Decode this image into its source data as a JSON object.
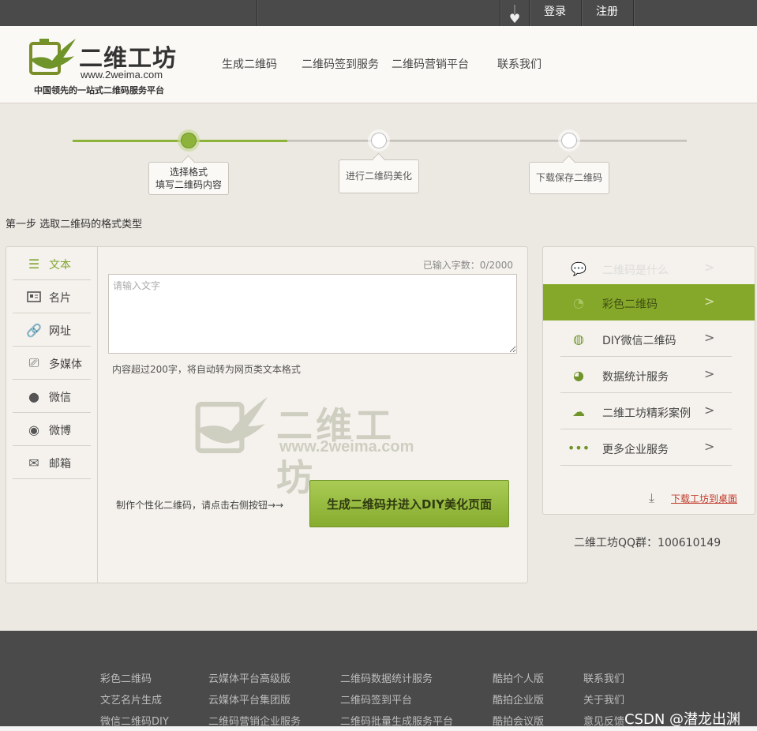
{
  "topbar": {
    "login": "登录",
    "register": "注册"
  },
  "header": {
    "logo_title": "二维工坊",
    "logo_url": "www.2weima.com",
    "slogan": "中国领先的一站式二维码服务平台",
    "nav": [
      "生成二维码",
      "二维码签到服务",
      "二维码营销平台",
      "联系我们"
    ]
  },
  "steps": [
    {
      "line1": "选择格式",
      "line2": "填写二维码内容"
    },
    {
      "line1": "进行二维码美化",
      "line2": ""
    },
    {
      "line1": "下载保存二维码",
      "line2": ""
    }
  ],
  "progress_fraction": 0.35,
  "step_label": "第一步 选取二维码的格式类型",
  "tabs": [
    {
      "label": "文本",
      "icon": "list-icon"
    },
    {
      "label": "名片",
      "icon": "card-icon"
    },
    {
      "label": "网址",
      "icon": "link-icon"
    },
    {
      "label": "多媒体",
      "icon": "media-icon"
    },
    {
      "label": "微信",
      "icon": "wechat-icon"
    },
    {
      "label": "微博",
      "icon": "weibo-icon"
    },
    {
      "label": "邮箱",
      "icon": "mail-icon"
    }
  ],
  "editor": {
    "count": "已输入字数：0/2000",
    "placeholder": "请输入文字",
    "hint": "内容超过200字，将自动转为网页类文本格式",
    "cta_note": "制作个性化二维码，请点击右侧按钮→→",
    "cta_label": "生成二维码并进入DIY美化页面"
  },
  "watermark": {
    "title": "二维工坊",
    "url": "www.2weima.com"
  },
  "right_menu": [
    {
      "label": "二维码是什么",
      "icon": "chat-icon"
    },
    {
      "label": "彩色二维码",
      "icon": "palette-icon"
    },
    {
      "label": "DIY微信二维码",
      "icon": "globe-icon"
    },
    {
      "label": "数据统计服务",
      "icon": "pie-chart-icon"
    },
    {
      "label": "二维工坊精彩案例",
      "icon": "cloud-icon"
    },
    {
      "label": "更多企业服务",
      "icon": "more-icon"
    }
  ],
  "arrow": ">",
  "download_label": "下载工坊到桌面",
  "qq_group": "二维工坊QQ群：100610149",
  "footer": {
    "col1": [
      "彩色二维码",
      "文艺名片生成",
      "微信二维码DIY"
    ],
    "col2": [
      "云媒体平台高级版",
      "云媒体平台集团版",
      "二维码营销企业服务"
    ],
    "col3": [
      "二维码数据统计服务",
      "二维码签到平台",
      "二维码批量生成服务平台"
    ],
    "col4": [
      "酷拍个人版",
      "酷拍企业版",
      "酷拍会议版"
    ],
    "col5": [
      "联系我们",
      "关于我们",
      "意见反馈"
    ]
  },
  "watermark_csdn": "CSDN @潜龙出渊",
  "colors": {
    "accent": "#8db33a",
    "dark_bar": "#4a4a4a",
    "page_bg": "#ece8e2",
    "link_red": "#c0392b"
  }
}
